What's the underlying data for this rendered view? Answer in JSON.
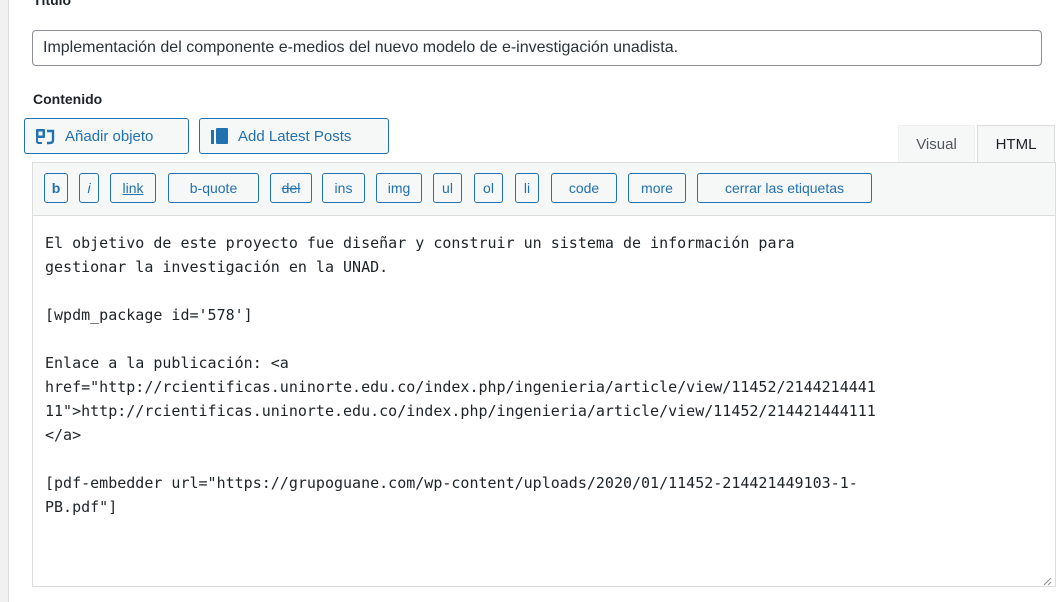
{
  "title_section": {
    "label": "Título",
    "value": "Implementación del componente e-medios del nuevo modelo de e-investigación unadista."
  },
  "content_section": {
    "label": "Contenido"
  },
  "media_buttons": {
    "add_object": {
      "label": "Añadir objeto",
      "icon": "add-media-icon"
    },
    "add_latest_posts": {
      "label": "Add Latest Posts",
      "icon": "posts-icon"
    }
  },
  "tabs": {
    "visual": "Visual",
    "html": "HTML",
    "active": "html"
  },
  "quicktags": [
    {
      "label": "b"
    },
    {
      "label": "i"
    },
    {
      "label": "link"
    },
    {
      "label": "b-quote"
    },
    {
      "label": "del"
    },
    {
      "label": "ins"
    },
    {
      "label": "img"
    },
    {
      "label": "ul"
    },
    {
      "label": "ol"
    },
    {
      "label": "li"
    },
    {
      "label": "code"
    },
    {
      "label": "more"
    },
    {
      "label": "cerrar las etiquetas"
    }
  ],
  "editor": {
    "content": "El objetivo de este proyecto fue diseñar y construir un sistema de información para\ngestionar la investigación en la UNAD.\n\n[wpdm_package id='578']\n\nEnlace a la publicación: <a\nhref=\"http://rcientificas.uninorte.edu.co/index.php/ingenieria/article/view/11452/2144214441\n11\">http://rcientificas.uninorte.edu.co/index.php/ingenieria/article/view/11452/214421444111\n</a>\n\n[pdf-embedder url=\"https://grupoguane.com/wp-content/uploads/2020/01/11452-214421449103-1-\nPB.pdf\"]"
  },
  "colors": {
    "accent": "#2271b1",
    "background": "#f1f1f1",
    "toolbar": "#f6f7f7"
  }
}
